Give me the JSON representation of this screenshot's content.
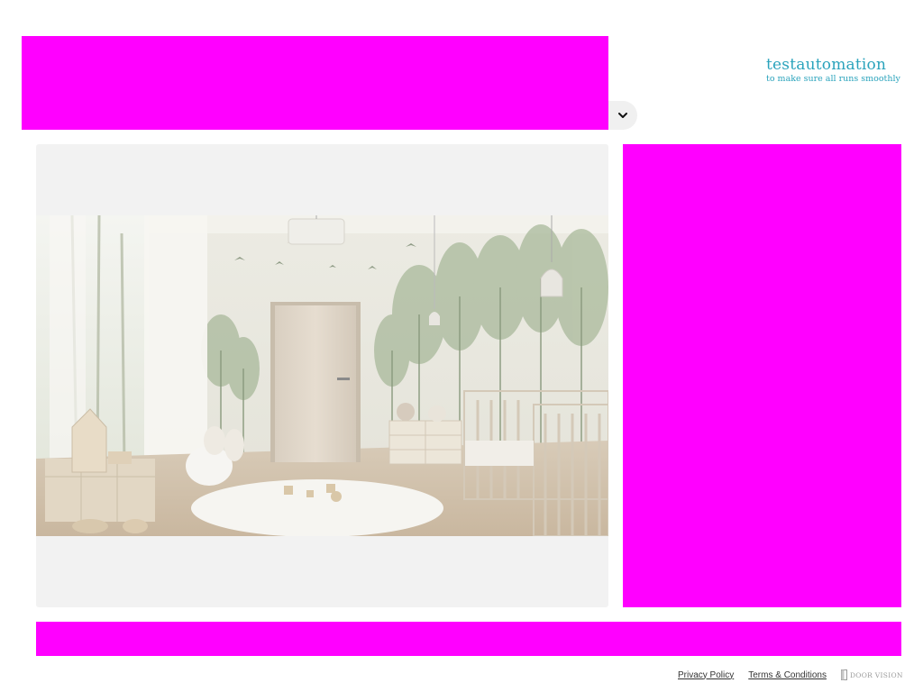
{
  "header": {
    "logo": {
      "name": "testautomation",
      "tagline": "to make sure all runs smoothly",
      "color": "#2aa3bc"
    },
    "collapse_icon": "chevron-down-icon"
  },
  "placeholders": {
    "color": "#ff00ff"
  },
  "image": {
    "icon": "nursery-room-photo"
  },
  "footer": {
    "privacy": "Privacy Policy",
    "terms": "Terms & Conditions",
    "brand": "DOOR VISION"
  }
}
